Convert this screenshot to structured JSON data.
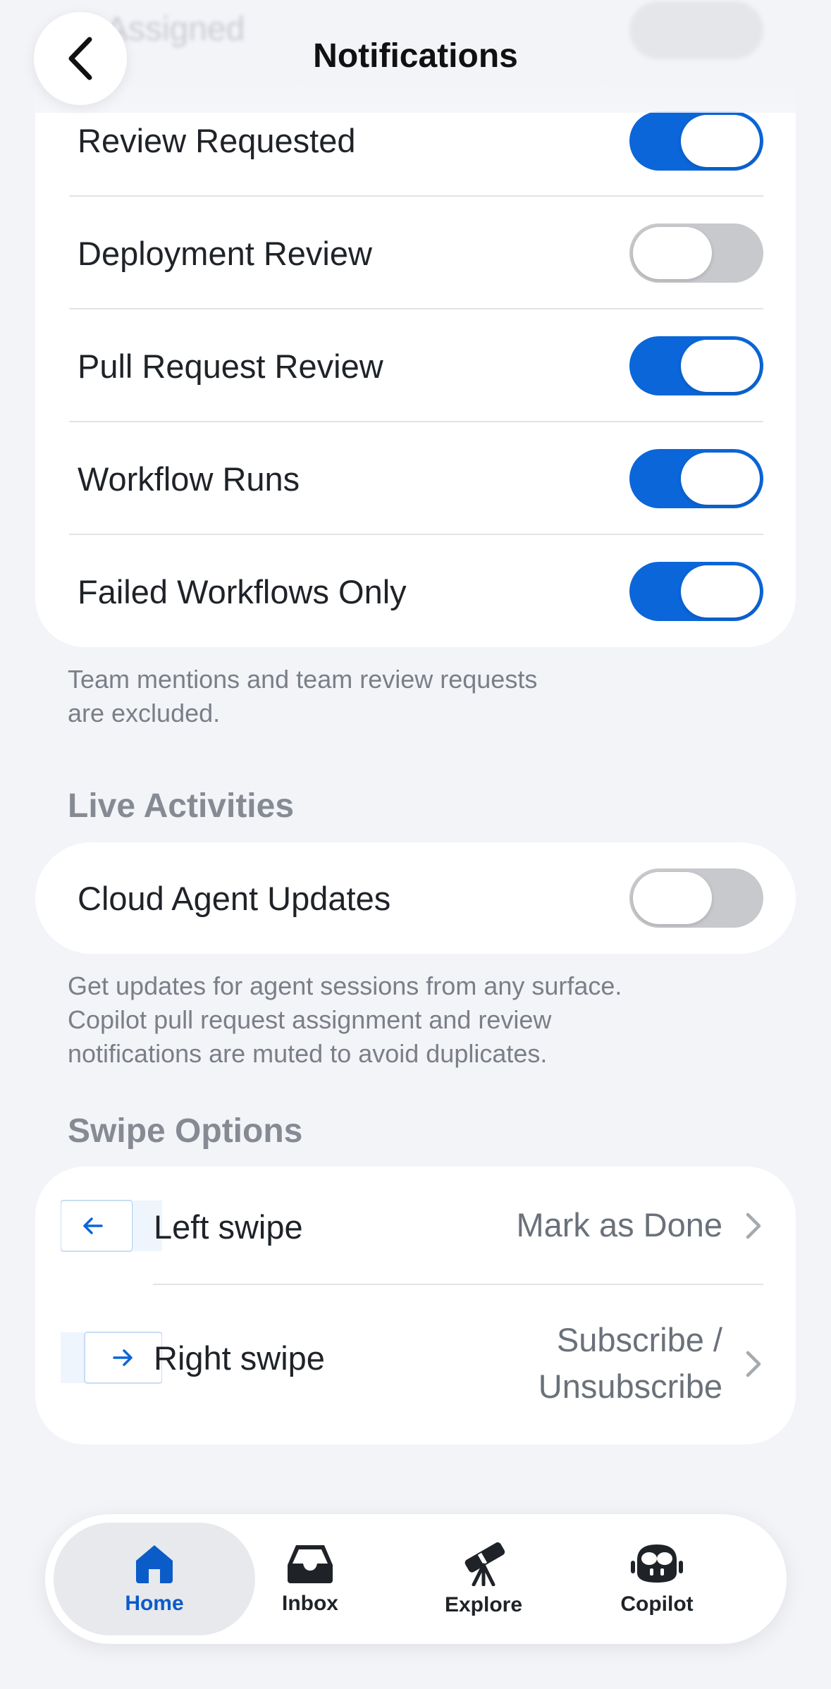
{
  "header": {
    "title": "Notifications",
    "ghost_text": "Assigned"
  },
  "notification_settings": {
    "items": [
      {
        "label": "Review Requested",
        "enabled": true
      },
      {
        "label": "Deployment Review",
        "enabled": false
      },
      {
        "label": "Pull Request Review",
        "enabled": true
      },
      {
        "label": "Workflow Runs",
        "enabled": true
      },
      {
        "label": "Failed Workflows Only",
        "enabled": true
      }
    ],
    "footnote_line1": "Team mentions and team review requests",
    "footnote_line2": "are excluded."
  },
  "live_activities": {
    "title": "Live Activities",
    "item": {
      "label": "Cloud Agent Updates",
      "enabled": false
    },
    "footnote_line1": "Get updates for agent sessions from any surface.",
    "footnote_line2": "Copilot pull request assignment and review",
    "footnote_line3": "notifications are muted to avoid duplicates."
  },
  "swipe_options": {
    "title": "Swipe Options",
    "left": {
      "label": "Left swipe",
      "value": "Mark as Done"
    },
    "right": {
      "label": "Right swipe",
      "value_line1": "Subscribe /",
      "value_line2": "Unsubscribe"
    }
  },
  "tabbar": {
    "tabs": [
      {
        "label": "Home",
        "icon": "home-icon",
        "active": true
      },
      {
        "label": "Inbox",
        "icon": "inbox-icon",
        "active": false
      },
      {
        "label": "Explore",
        "icon": "telescope-icon",
        "active": false
      },
      {
        "label": "Copilot",
        "icon": "copilot-icon",
        "active": false
      }
    ]
  },
  "colors": {
    "accent": "#0b66d9",
    "toggle_off": "#c8c9cc",
    "background": "#f3f4f8"
  }
}
